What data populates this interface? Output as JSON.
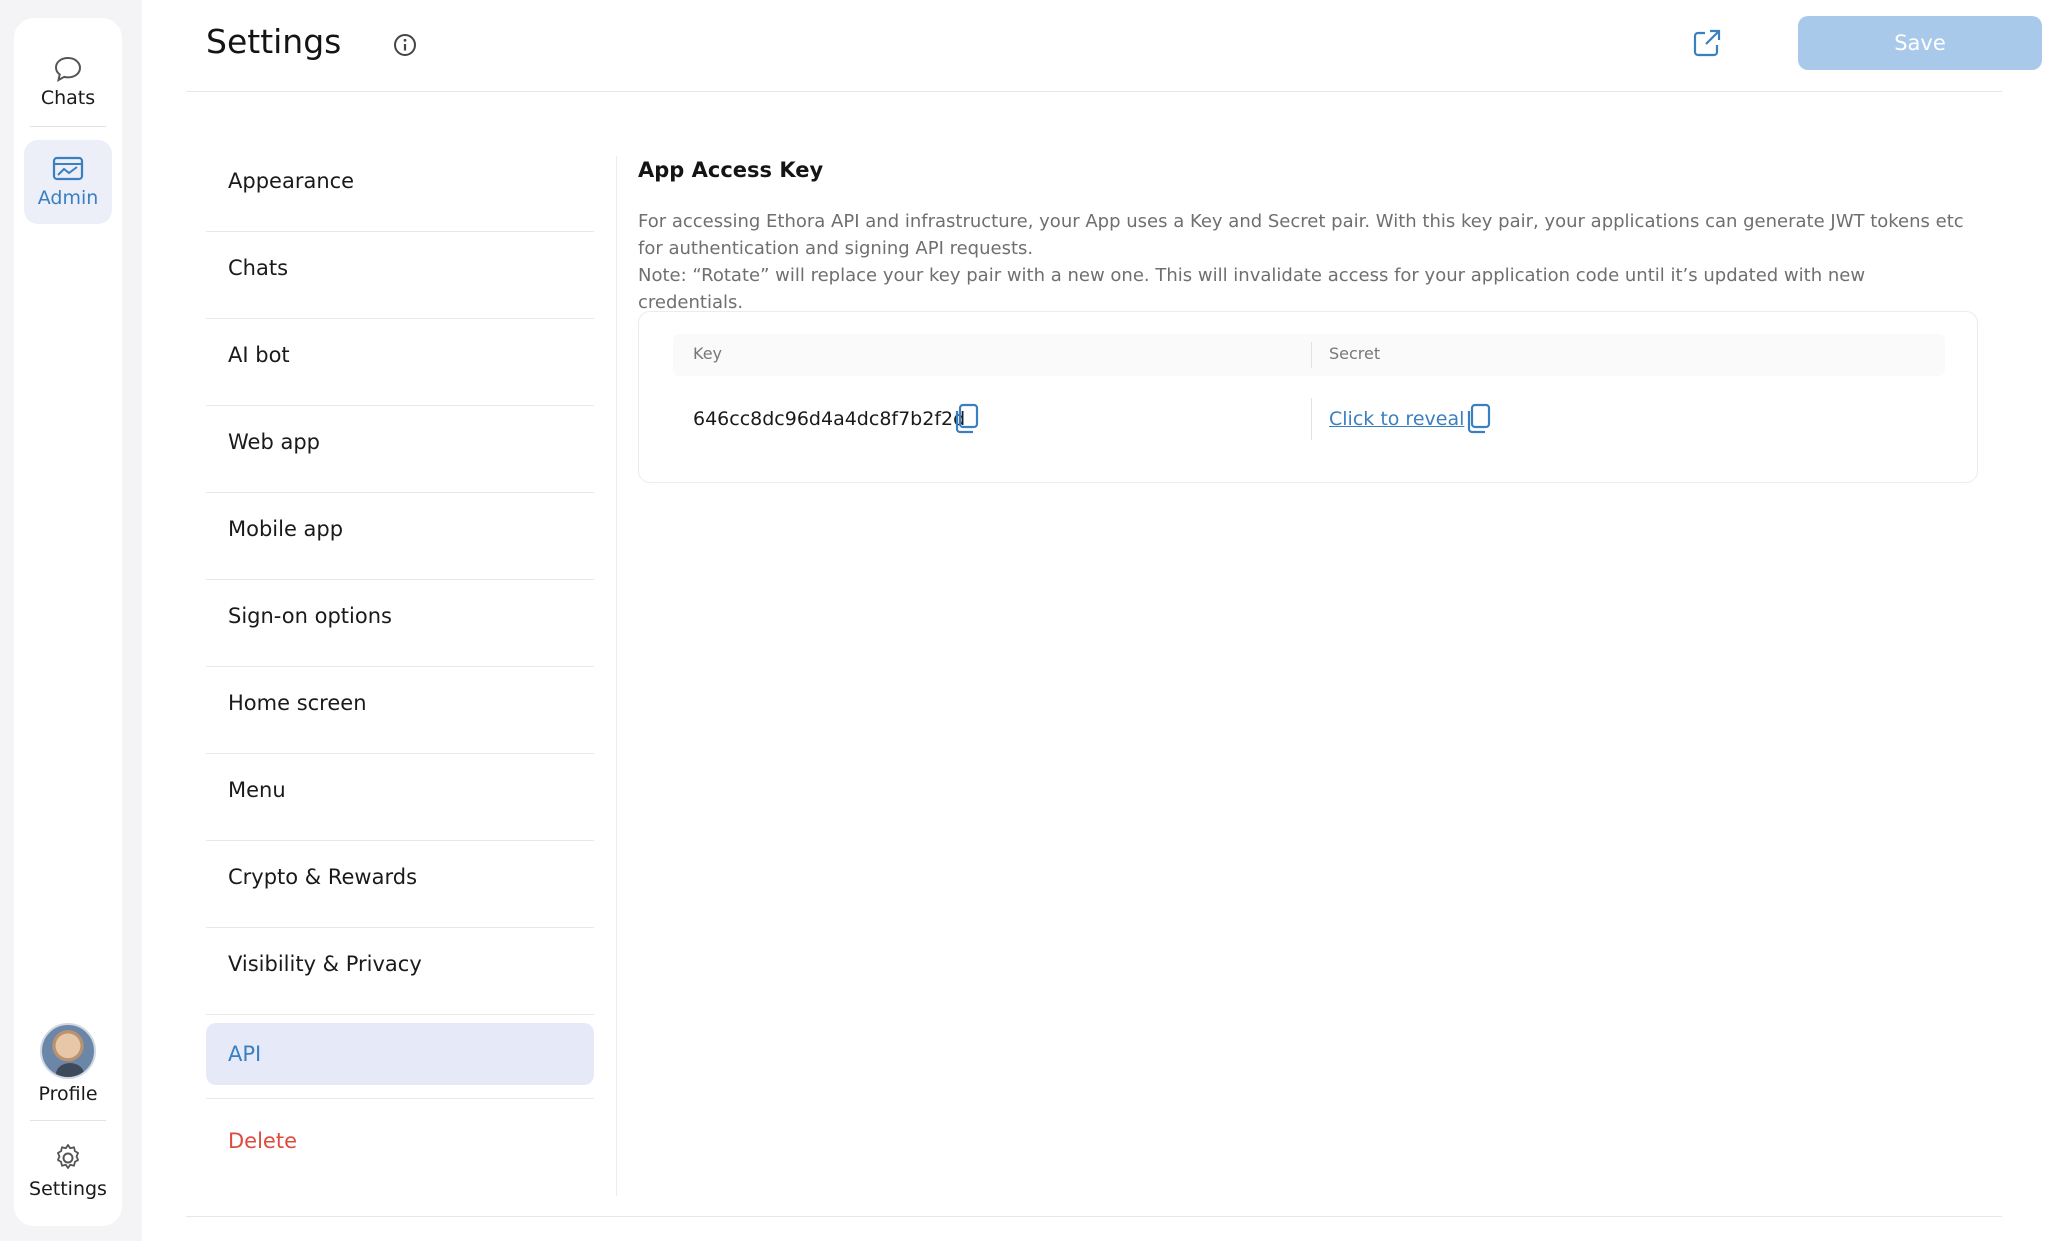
{
  "rail": {
    "items": [
      {
        "label": "Chats",
        "icon": "chat-bubble-icon"
      },
      {
        "label": "Admin",
        "icon": "admin-dashboard-icon",
        "active": true
      }
    ],
    "bottom": [
      {
        "label": "Profile",
        "icon": "avatar"
      },
      {
        "label": "Settings",
        "icon": "gear-icon"
      }
    ]
  },
  "header": {
    "title": "Settings",
    "save_label": "Save"
  },
  "nav": {
    "items": [
      {
        "label": "Appearance"
      },
      {
        "label": "Chats"
      },
      {
        "label": "AI bot"
      },
      {
        "label": "Web app"
      },
      {
        "label": "Mobile app"
      },
      {
        "label": "Sign-on options"
      },
      {
        "label": "Home screen"
      },
      {
        "label": "Menu"
      },
      {
        "label": "Crypto & Rewards"
      },
      {
        "label": "Visibility & Privacy"
      },
      {
        "label": "API",
        "active": true
      },
      {
        "label": "Delete",
        "danger": true
      }
    ]
  },
  "content": {
    "title": "App Access Key",
    "description_line1": "For accessing Ethora API and infrastructure, your App uses a Key and Secret pair. With this key pair, your applications can generate JWT tokens etc for authentication and signing API requests.",
    "description_line2": "Note: “Rotate” will replace your key pair with a new one. This will invalidate access for your application code until it’s updated with new credentials.",
    "table": {
      "col_key": "Key",
      "col_secret": "Secret",
      "key_value": "646cc8dc96d4a4dc8f7b2f2d",
      "secret_link": "Click to reveal"
    }
  },
  "colors": {
    "accent": "#3a7fc1",
    "save_bg": "#a9c9ea",
    "danger": "#e04a3f",
    "active_bg": "#e6e9f7"
  }
}
